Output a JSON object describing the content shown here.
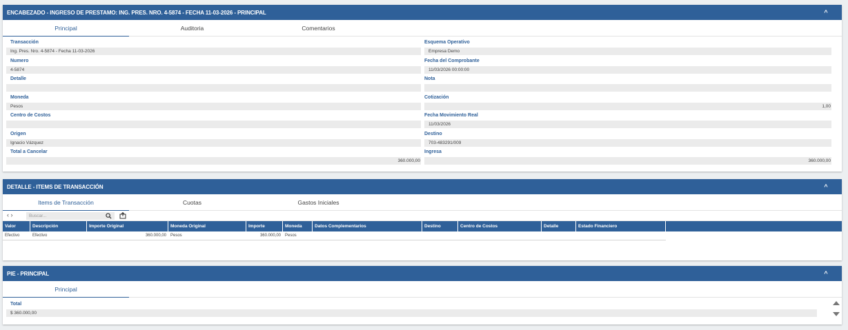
{
  "header_panel": {
    "title": "ENCABEZADO - INGRESO DE PRESTAMO: ING. PRES. NRO. 4-5874 - FECHA 11-03-2026 - PRINCIPAL",
    "tabs": [
      "Principal",
      "Auditoria",
      "Comentarios"
    ],
    "fields": {
      "transaccion": {
        "label": "Transacción",
        "value": "Ing. Pres. Nro.  4-5874 - Fecha 11-03-2026"
      },
      "esquema": {
        "label": "Esquema Operativo",
        "value": "Empresa Demo"
      },
      "numero": {
        "label": "Numero",
        "value": "4-5874"
      },
      "fecha_comprobante": {
        "label": "Fecha del Comprobante",
        "value": "11/03/2026 00:00:00"
      },
      "detalle": {
        "label": "Detalle",
        "value": ""
      },
      "nota": {
        "label": "Nota",
        "value": ""
      },
      "moneda": {
        "label": "Moneda",
        "value": "Pesos"
      },
      "cotizacion": {
        "label": "Cotización",
        "value": "1,00"
      },
      "centro_costos": {
        "label": "Centro de Costos",
        "value": ""
      },
      "fecha_mov": {
        "label": "Fecha Movimiento Real",
        "value": "11/03/2026"
      },
      "origen": {
        "label": "Origen",
        "value": "Ignacio Vázquez"
      },
      "destino": {
        "label": "Destino",
        "value": "703-483291/009"
      },
      "total_cancelar": {
        "label": "Total a Cancelar",
        "value": "360.000,00"
      },
      "ingresa": {
        "label": "Ingresa",
        "value": "360.000,00"
      }
    }
  },
  "detail_panel": {
    "title": "DETALLE - ITEMS DE TRANSACCIÓN",
    "tabs": [
      "Items de Transacción",
      "Cuotas",
      "Gastos Iniciales"
    ],
    "nav_arrows": "‹ ›",
    "search_placeholder": "Buscar...",
    "columns": [
      "Valor",
      "Descripción",
      "Importe Original",
      "Moneda Original",
      "Importe",
      "Moneda",
      "Datos Complementarios",
      "Destino",
      "Centro de Costos",
      "Detalle",
      "Estado Financiero"
    ],
    "rows": [
      [
        "Efectivo",
        "Efectivo",
        "360.000,00",
        "Pesos",
        "360.000,00",
        "Pesos",
        "",
        "",
        "",
        "",
        ""
      ]
    ]
  },
  "footer_panel": {
    "title": "PIE - PRINCIPAL",
    "tabs": [
      "Principal"
    ],
    "total_label": "Total",
    "total_value": "$ 360.000,00"
  },
  "colors": {
    "header_bg": "#2f6099",
    "field_bg": "#ebebeb",
    "label": "#2f6099"
  }
}
